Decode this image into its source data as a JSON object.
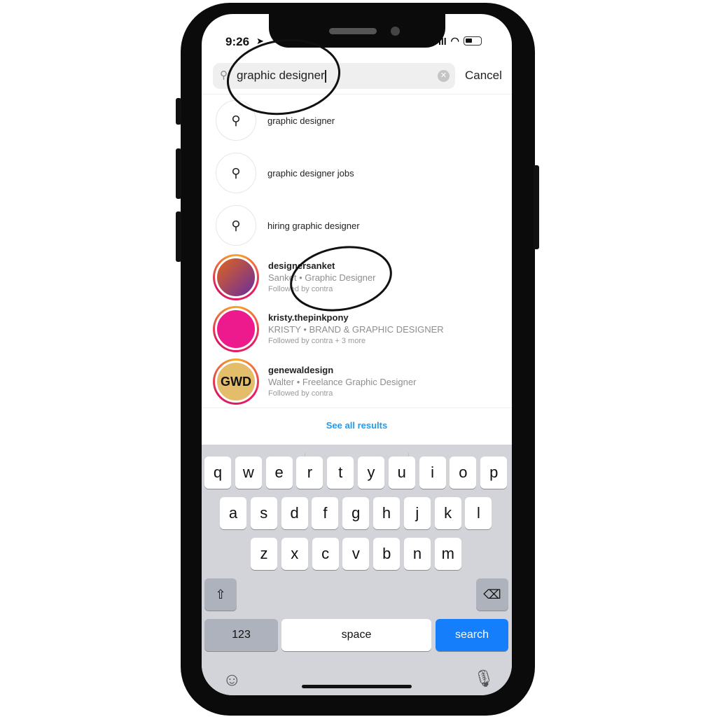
{
  "status": {
    "time": "9:26"
  },
  "search": {
    "query": "graphic designer",
    "cancel": "Cancel"
  },
  "suggestions": [
    {
      "label": "graphic designer"
    },
    {
      "label": "graphic designer jobs"
    },
    {
      "label": "hiring graphic designer"
    }
  ],
  "accounts": [
    {
      "username": "designersanket",
      "bio": "Sanket • Graphic Designer",
      "followed": "Followed by contra",
      "avatar_color": "#7b3fa0"
    },
    {
      "username": "kristy.thepinkpony",
      "bio": "KRISTY • BRAND & GRAPHIC DESIGNER",
      "followed": "Followed by contra + 3 more",
      "avatar_color": "#ec1a8c"
    },
    {
      "username": "genewaldesign",
      "bio": "Walter • Freelance Graphic Designer",
      "followed": "Followed by contra",
      "avatar_color": "#e3bd6a",
      "avatar_text": "GWD"
    }
  ],
  "see_all": "See all results",
  "keyboard": {
    "row1": [
      "q",
      "w",
      "e",
      "r",
      "t",
      "y",
      "u",
      "i",
      "o",
      "p"
    ],
    "row2": [
      "a",
      "s",
      "d",
      "f",
      "g",
      "h",
      "j",
      "k",
      "l"
    ],
    "row3": [
      "z",
      "x",
      "c",
      "v",
      "b",
      "n",
      "m"
    ],
    "numbers": "123",
    "space": "space",
    "search": "search"
  }
}
